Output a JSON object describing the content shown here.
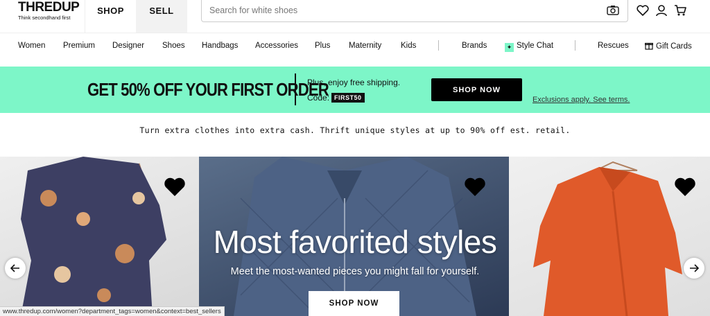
{
  "logo": {
    "word": "THREDUP",
    "tagline": "Think secondhand first"
  },
  "header": {
    "tabs": [
      "SHOP",
      "SELL"
    ],
    "search_placeholder": "Search for white shoes"
  },
  "nav": {
    "items": [
      "Women",
      "Premium",
      "Designer",
      "Shoes",
      "Handbags",
      "Accessories",
      "Plus",
      "Maternity",
      "Kids"
    ],
    "brands": "Brands",
    "style_chat": "Style Chat",
    "rescues": "Rescues",
    "gift_cards": "Gift Cards"
  },
  "promo": {
    "headline": "GET 50% OFF YOUR FIRST ORDER",
    "shipping": "Plus, enjoy free shipping.",
    "code_label": "Code:",
    "code": "FIRST50",
    "button": "SHOP NOW",
    "link": "Exclusions apply. See terms."
  },
  "tagline": "Turn extra clothes into extra cash. Thrift unique styles at up to 90% off est. retail.",
  "hero": {
    "title": "Most favorited styles",
    "subtitle": "Meet the most-wanted pieces you might fall for yourself.",
    "button": "SHOP NOW"
  },
  "status_url": "www.thredup.com/women?department_tags=women&context=best_sellers",
  "colors": {
    "accent": "#7df6c8",
    "button": "#000000"
  }
}
